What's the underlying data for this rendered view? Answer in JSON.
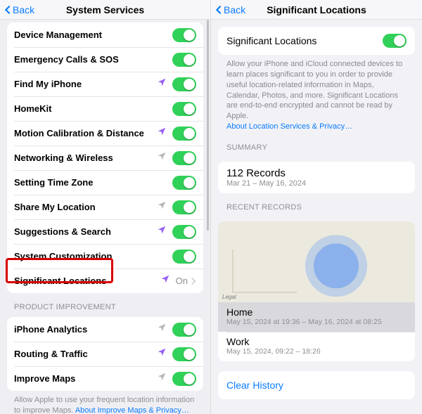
{
  "left": {
    "back": "Back",
    "title": "System Services",
    "items": [
      {
        "label": "Device Management",
        "icon": null,
        "toggle": true
      },
      {
        "label": "Emergency Calls & SOS",
        "icon": null,
        "toggle": true
      },
      {
        "label": "Find My iPhone",
        "icon": "purple",
        "toggle": true
      },
      {
        "label": "HomeKit",
        "icon": null,
        "toggle": true
      },
      {
        "label": "Motion Calibration & Distance",
        "icon": "purple",
        "toggle": true
      },
      {
        "label": "Networking & Wireless",
        "icon": "gray",
        "toggle": true
      },
      {
        "label": "Setting Time Zone",
        "icon": null,
        "toggle": true
      },
      {
        "label": "Share My Location",
        "icon": "gray",
        "toggle": true
      },
      {
        "label": "Suggestions & Search",
        "icon": "purple",
        "toggle": true
      },
      {
        "label": "System Customization",
        "icon": null,
        "toggle": true
      },
      {
        "label": "Significant Locations",
        "icon": "purple",
        "nav": true,
        "value": "On"
      }
    ],
    "sectionHeader": "PRODUCT IMPROVEMENT",
    "items2": [
      {
        "label": "iPhone Analytics",
        "icon": "gray",
        "toggle": true
      },
      {
        "label": "Routing & Traffic",
        "icon": "purple",
        "toggle": true
      },
      {
        "label": "Improve Maps",
        "icon": "gray",
        "toggle": true
      }
    ],
    "footer": "Allow Apple to use your frequent location information to improve Maps. ",
    "footerLink": "About Improve Maps & Privacy…"
  },
  "right": {
    "back": "Back",
    "title": "Significant Locations",
    "switchLabel": "Significant Locations",
    "desc": "Allow your iPhone and iCloud connected devices to learn places significant to you in order to provide useful location-related information in Maps, Calendar, Photos, and more. Significant Locations are end-to-end encrypted and cannot be read by Apple.",
    "descLink": "About Location Services & Privacy…",
    "summaryHeader": "SUMMARY",
    "summaryValue": "112 Records",
    "summaryRange": "Mar 21 – May 16, 2024",
    "recentHeader": "RECENT RECORDS",
    "mapLegal": "Legal",
    "records": [
      {
        "title": "Home",
        "sub": "May 15, 2024 at 19:36 – May 16, 2024 at 08:25",
        "selected": true
      },
      {
        "title": "Work",
        "sub": "May 15, 2024, 09:22 – 18:26",
        "selected": false
      }
    ],
    "clear": "Clear History"
  }
}
